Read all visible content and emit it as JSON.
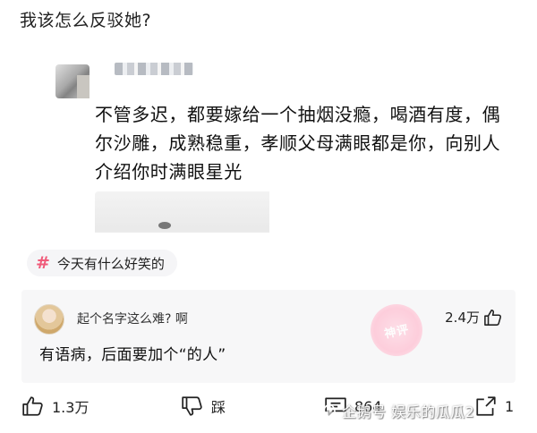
{
  "post": {
    "title": "我该怎么反驳她?",
    "quote_text": "不管多迟，都要嫁给一个抽烟没瘾，喝酒有度，偶尔沙雕，成熟稳重，孝顺父母满眼都是你，向别人介绍你时满眼星光"
  },
  "topic": {
    "symbol": "#",
    "label": "今天有什么好笑的"
  },
  "top_comment": {
    "author": "起个名字这么难? 啊",
    "likes": "2.4万",
    "text": "有语病，后面要加个“的人”",
    "seal_text": "神评"
  },
  "actions": {
    "like_count": "1.3万",
    "dislike_label": "踩",
    "comment_count": "864",
    "share_count": "1"
  },
  "source_watermark": {
    "text": "企鹅号 娱乐的瓜瓜2"
  },
  "colors": {
    "topic_hash": "#f05b7a",
    "comment_card_bg": "#f7f7f8",
    "seal_pink": "#ffc0d2"
  },
  "icons": [
    "thumb-up-icon",
    "thumb-down-icon",
    "comment-icon",
    "share-icon",
    "penguin-icon"
  ]
}
